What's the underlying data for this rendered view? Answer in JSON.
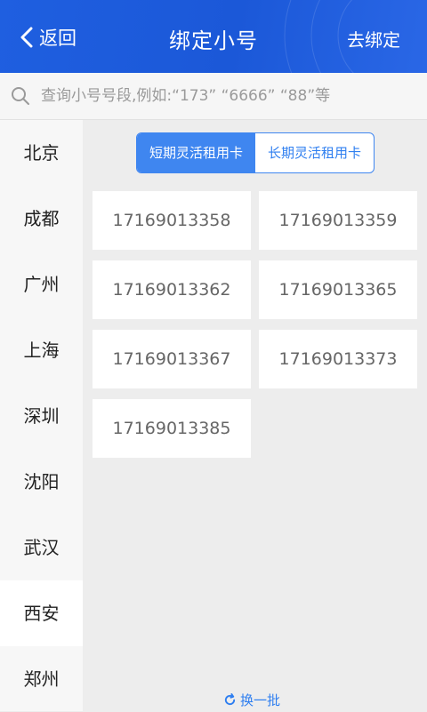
{
  "header": {
    "back_label": "返回",
    "title": "绑定小号",
    "action_label": "去绑定"
  },
  "search": {
    "placeholder": "查询小号号段,例如:“173” “6666” “88”等"
  },
  "sidebar": {
    "cities": [
      "北京",
      "成都",
      "广州",
      "上海",
      "深圳",
      "沈阳",
      "武汉",
      "西安",
      "郑州"
    ],
    "active_index": 7
  },
  "tabs": {
    "items": [
      "短期灵活租用卡",
      "长期灵活租用卡"
    ],
    "active_index": 0
  },
  "numbers": [
    "17169013358",
    "17169013359",
    "17169013362",
    "17169013365",
    "17169013367",
    "17169013373",
    "17169013385"
  ],
  "refresh_label": "换一批",
  "colors": {
    "header_blue": "#1f5fe0",
    "accent": "#3f86f0"
  }
}
